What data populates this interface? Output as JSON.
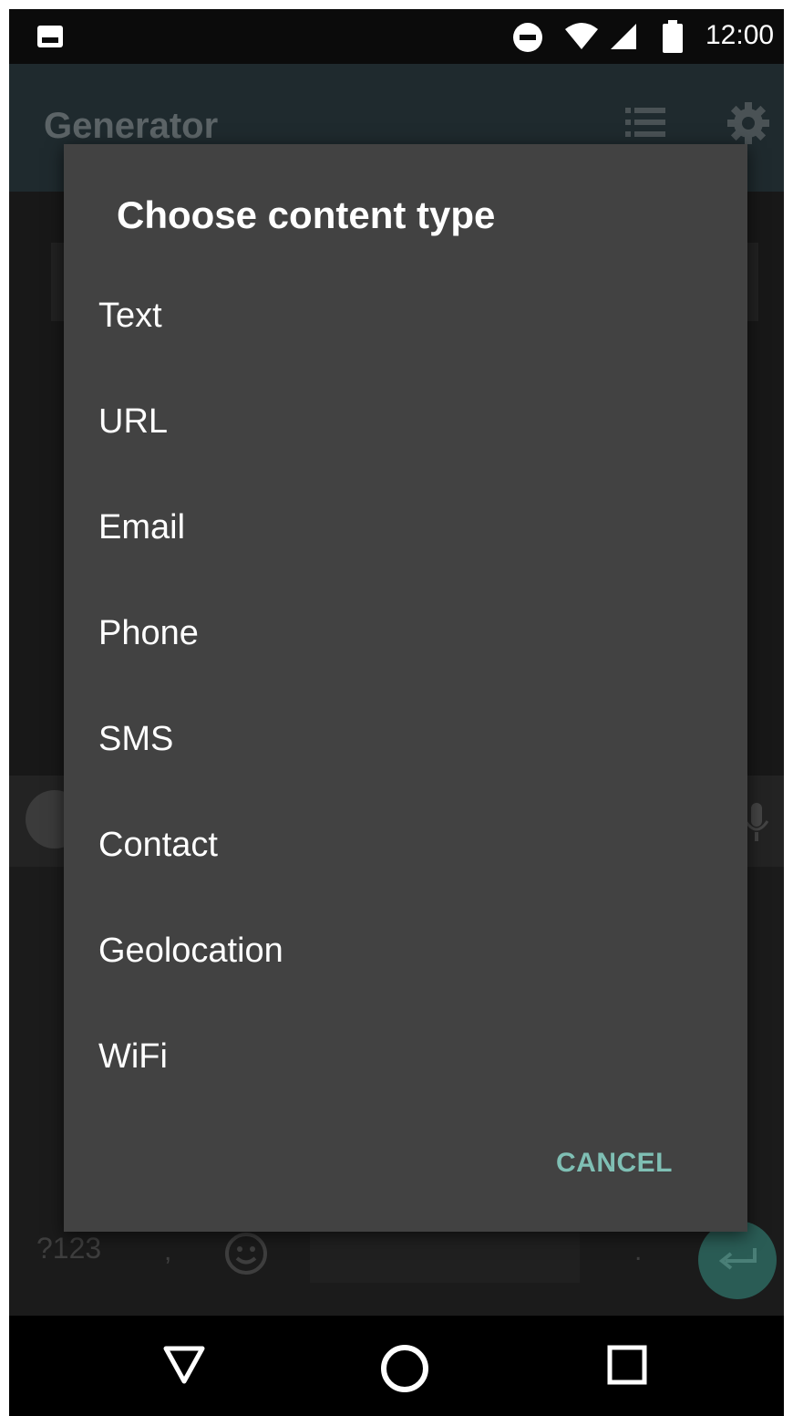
{
  "status_bar": {
    "time": "12:00",
    "icons": [
      "photo-icon",
      "do-not-disturb-icon",
      "wifi-icon",
      "signal-icon",
      "battery-icon"
    ]
  },
  "app_bar": {
    "title": "Generator",
    "icons": [
      "list-icon",
      "gear-icon"
    ]
  },
  "keyboard": {
    "symbols_key": "?123",
    "comma_key": ",",
    "period_key": ".",
    "icons": [
      "google-icon",
      "mic-icon",
      "emoji-icon",
      "enter-icon"
    ]
  },
  "dialog": {
    "title": "Choose content type",
    "options": [
      {
        "label": "Text"
      },
      {
        "label": "URL"
      },
      {
        "label": "Email"
      },
      {
        "label": "Phone"
      },
      {
        "label": "SMS"
      },
      {
        "label": "Contact"
      },
      {
        "label": "Geolocation"
      },
      {
        "label": "WiFi"
      }
    ],
    "cancel_label": "CANCEL"
  },
  "nav_bar": {
    "icons": [
      "back-icon",
      "home-icon",
      "recent-apps-icon"
    ]
  },
  "colors": {
    "dialog_background": "#424242",
    "accent": "#7fbfb4",
    "app_bar": "#1f2a2e"
  }
}
